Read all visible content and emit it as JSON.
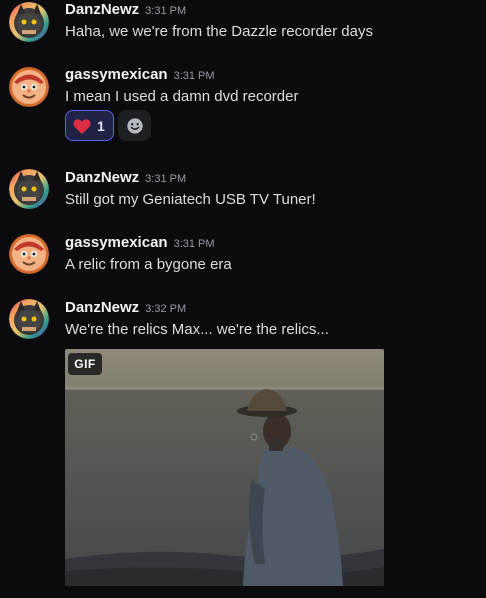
{
  "messages": [
    {
      "author": "DanzNewz",
      "time": "3:31 PM",
      "text": "Haha, we we're from the Dazzle recorder days"
    },
    {
      "author": "gassymexican",
      "time": "3:31 PM",
      "text": "I mean I used a damn dvd recorder",
      "reactions": [
        {
          "emoji": "heart-icon",
          "count": "1"
        }
      ]
    },
    {
      "author": "DanzNewz",
      "time": "3:31 PM",
      "text": "Still got my Geniatech USB TV Tuner!"
    },
    {
      "author": "gassymexican",
      "time": "3:31 PM",
      "text": "A relic from a bygone era"
    },
    {
      "author": "DanzNewz",
      "time": "3:32 PM",
      "text": "We're the relics Max... we're the relics...",
      "attachment": {
        "badge": "GIF"
      }
    }
  ],
  "colors": {
    "background": "#0b0b0e",
    "username": "#f2f3f5",
    "text": "#dbdee1",
    "timestamp": "#949ba4",
    "reaction_border": "#5865f2",
    "reaction_bg": "#1f2245"
  }
}
